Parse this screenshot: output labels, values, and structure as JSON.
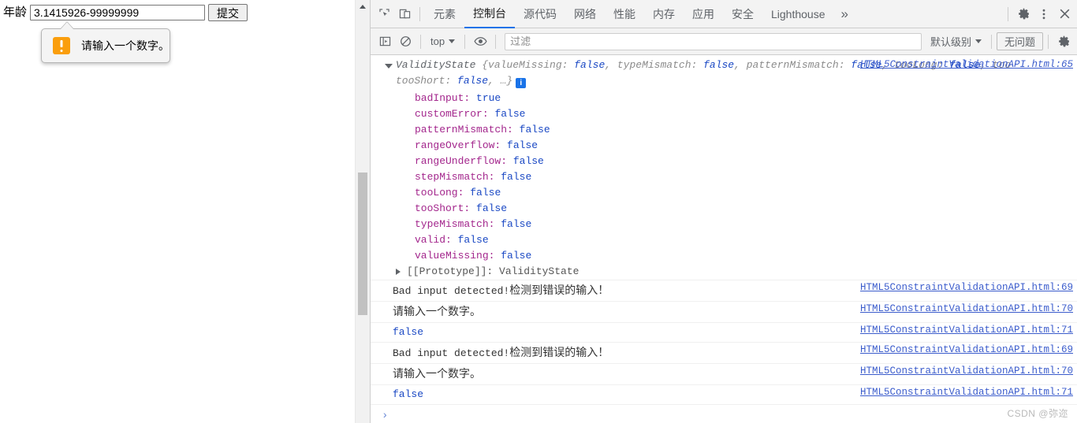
{
  "page": {
    "form": {
      "label": "年龄",
      "input_value": "3.1415926-99999999",
      "input_placeholder": "",
      "submit_label": "提交"
    },
    "validation_bubble": {
      "icon": "warning-exclamation-icon",
      "text": "请输入一个数字。"
    }
  },
  "devtools": {
    "toolbar": {
      "inspect_icon": "inspect-element-icon",
      "device_icon": "device-toolbar-icon",
      "tabs": [
        {
          "label": "元素",
          "active": false
        },
        {
          "label": "控制台",
          "active": true
        },
        {
          "label": "源代码",
          "active": false
        },
        {
          "label": "网络",
          "active": false
        },
        {
          "label": "性能",
          "active": false
        },
        {
          "label": "内存",
          "active": false
        },
        {
          "label": "应用",
          "active": false
        },
        {
          "label": "安全",
          "active": false
        },
        {
          "label": "Lighthouse",
          "active": false
        }
      ],
      "more_tabs_label": "»",
      "settings_icon": "gear-icon",
      "kebab_icon": "more-vertical-icon",
      "close_icon": "close-icon"
    },
    "filterbar": {
      "sidebar_icon": "console-sidebar-icon",
      "clear_icon": "clear-console-icon",
      "context_value": "top",
      "eye_icon": "live-expression-eye-icon",
      "filter_placeholder": "过滤",
      "filter_value": "",
      "level_value": "默认级别",
      "issues_label": "无问题",
      "console_settings_icon": "gear-icon"
    },
    "console": {
      "object_entry": {
        "source": "HTML5ConstraintValidationAPI.html:65",
        "class_name": "ValidityState",
        "preview_prefix": " {",
        "preview_pairs": [
          {
            "key": "valueMissing: ",
            "value": "false"
          },
          {
            "key": "typeMismatch: ",
            "value": "false"
          },
          {
            "key": "patternMismatch: ",
            "value": "false"
          },
          {
            "key": "tooLong: ",
            "value": "false"
          }
        ],
        "preview_tail_key": "tooShort: ",
        "preview_tail_value": "false",
        "preview_suffix": ", …}",
        "info_badge": "i",
        "properties": [
          {
            "key": "badInput:",
            "value": "true"
          },
          {
            "key": "customError:",
            "value": "false"
          },
          {
            "key": "patternMismatch:",
            "value": "false"
          },
          {
            "key": "rangeOverflow:",
            "value": "false"
          },
          {
            "key": "rangeUnderflow:",
            "value": "false"
          },
          {
            "key": "stepMismatch:",
            "value": "false"
          },
          {
            "key": "tooLong:",
            "value": "false"
          },
          {
            "key": "tooShort:",
            "value": "false"
          },
          {
            "key": "typeMismatch:",
            "value": "false"
          },
          {
            "key": "valid:",
            "value": "false"
          },
          {
            "key": "valueMissing:",
            "value": "false"
          }
        ],
        "prototype_label": "[[Prototype]]: ValidityState"
      },
      "log_rows": [
        {
          "kind": "mixed",
          "mono": "Bad input detected!",
          "cn": "检测到错误的输入！",
          "source": "HTML5ConstraintValidationAPI.html:69"
        },
        {
          "kind": "cn",
          "cn": "请输入一个数字。",
          "source": "HTML5ConstraintValidationAPI.html:70"
        },
        {
          "kind": "bool",
          "value": "false",
          "source": "HTML5ConstraintValidationAPI.html:71"
        },
        {
          "kind": "mixed",
          "mono": "Bad input detected!",
          "cn": "检测到错误的输入！",
          "source": "HTML5ConstraintValidationAPI.html:69"
        },
        {
          "kind": "cn",
          "cn": "请输入一个数字。",
          "source": "HTML5ConstraintValidationAPI.html:70"
        },
        {
          "kind": "bool",
          "value": "false",
          "source": "HTML5ConstraintValidationAPI.html:71"
        }
      ],
      "prompt_caret": "›"
    }
  },
  "watermark": "CSDN @弥迩"
}
